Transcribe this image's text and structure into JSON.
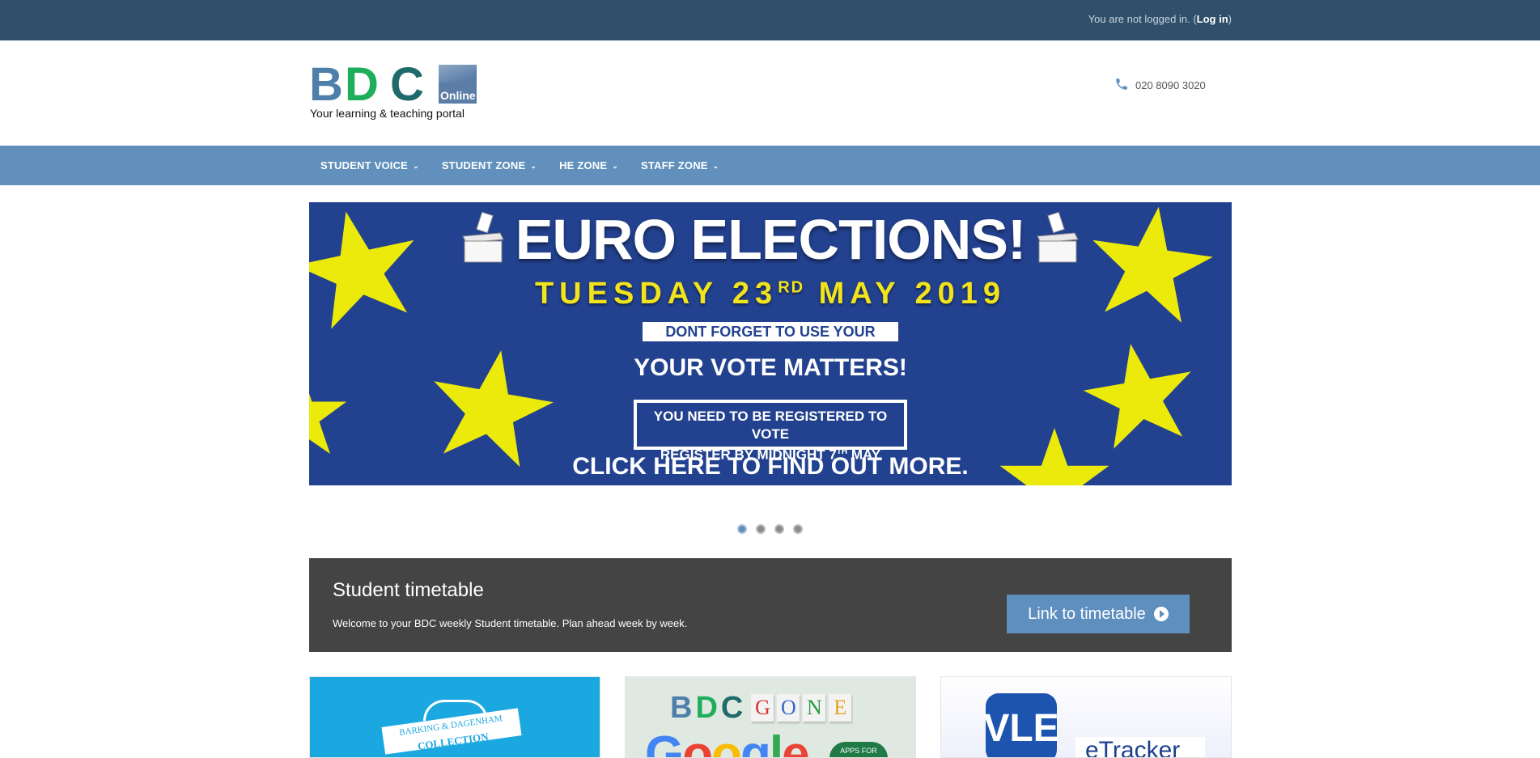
{
  "topbar": {
    "login_text": "You are not logged in. (",
    "login_link": "Log in",
    "login_close": ")"
  },
  "header": {
    "logo": {
      "letters": [
        "B",
        "D",
        "C"
      ],
      "letter_colors": [
        "#4d7faa",
        "#1fae5b",
        "#1f6b6a"
      ],
      "badge": "Online",
      "tagline": "Your learning & teaching portal"
    },
    "phone": {
      "icon": "phone-icon",
      "number": "020 8090 3020"
    }
  },
  "nav": {
    "items": [
      {
        "label": "STUDENT VOICE"
      },
      {
        "label": "STUDENT ZONE"
      },
      {
        "label": "HE ZONE"
      },
      {
        "label": "STAFF ZONE"
      }
    ]
  },
  "banner": {
    "title": "EURO ELECTIONS!",
    "date_main": "TUESDAY 23",
    "date_sup": "RD",
    "date_end": " MAY 2019",
    "reminder": "DONT FORGET TO USE YOUR VOTE!",
    "matters": "YOUR VOTE MATTERS!",
    "box_line1": "YOU NEED TO BE REGISTERED TO VOTE",
    "box_line2_main": "REGISTER BY MIDNIGHT 7",
    "box_line2_sup": "TH",
    "box_line2_end": " MAY",
    "cta": "CLICK HERE TO FIND OUT MORE.",
    "colors": {
      "background": "#22418f",
      "stars": "#ecea0a",
      "date": "#f2e41c"
    }
  },
  "carousel": {
    "slide_count": 4,
    "active_index": 0
  },
  "timetable": {
    "title": "Student timetable",
    "description": "Welcome to your BDC weekly Student timetable. Plan ahead week by week.",
    "button_label": "Link to timetable",
    "button_icon": "play-circle-icon"
  },
  "cards": {
    "card1": {
      "ribbon_text": "BARKING & DAGENHAM",
      "ribbon_sub": "COLLECTION"
    },
    "card2": {
      "bdc": [
        "B",
        "D",
        "C"
      ],
      "gone": [
        "G",
        "O",
        "N",
        "E"
      ],
      "google": "Google",
      "badge": "APPS FOR"
    },
    "card3": {
      "logo": "VLE",
      "label": "eTracker"
    }
  }
}
